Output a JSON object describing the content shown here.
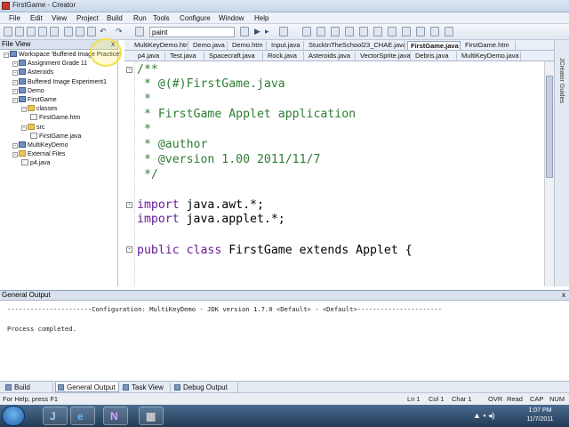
{
  "window": {
    "title": "FirstGame - Creator"
  },
  "menu": [
    "File",
    "Edit",
    "View",
    "Project",
    "Build",
    "Run",
    "Tools",
    "Configure",
    "Window",
    "Help"
  ],
  "toolbar": {
    "combo_value": "paint"
  },
  "fileview": {
    "title": "File View",
    "close": "x",
    "tree": [
      {
        "label": "Workspace 'Buffered Image Practice'",
        "kind": "prj",
        "indent": 0
      },
      {
        "label": "Assignment Grade 11",
        "kind": "prj",
        "indent": 1
      },
      {
        "label": "Asteroids",
        "kind": "prj",
        "indent": 1
      },
      {
        "label": "Buffered Image Experiment1",
        "kind": "prj",
        "indent": 1
      },
      {
        "label": "Demo",
        "kind": "prj",
        "indent": 1
      },
      {
        "label": "FirstGame",
        "kind": "prj",
        "indent": 1
      },
      {
        "label": "classes",
        "kind": "fold",
        "indent": 2
      },
      {
        "label": "FirstGame.htm",
        "kind": "file",
        "indent": 3
      },
      {
        "label": "src",
        "kind": "fold",
        "indent": 2
      },
      {
        "label": "FirstGame.java",
        "kind": "file",
        "indent": 3
      },
      {
        "label": "MultiKeyDemo",
        "kind": "prj",
        "indent": 1
      },
      {
        "label": "External Files",
        "kind": "fold",
        "indent": 1
      },
      {
        "label": "p4.java",
        "kind": "file",
        "indent": 2
      }
    ]
  },
  "tabs_row1": [
    "MultiKeyDemo.htm",
    "Demo.java",
    "Demo.htm",
    "Input.java",
    "StuckInTheSchool23_CHAE.java",
    "FirstGame.java",
    "FirstGame.htm"
  ],
  "tabs_row2": [
    "p4.java",
    "Test.java",
    "Spacecraft.java",
    "Rock.java",
    "Asteroids.java",
    "VectorSprite.java",
    "Debris.java",
    "MultiKeyDemo.java"
  ],
  "editor": {
    "lines": [
      {
        "cls": "cm",
        "text": "/**"
      },
      {
        "cls": "cm",
        "text": " * @(#)FirstGame.java"
      },
      {
        "cls": "cm",
        "text": " *"
      },
      {
        "cls": "cm",
        "text": " * FirstGame Applet application"
      },
      {
        "cls": "cm",
        "text": " *"
      },
      {
        "cls": "cm",
        "text": " * @author"
      },
      {
        "cls": "cm",
        "text": " * @version 1.00 2011/11/7"
      },
      {
        "cls": "cm",
        "text": " */"
      },
      {
        "cls": "pl",
        "text": ""
      },
      {
        "cls": "kw",
        "text": "import",
        "rest": " java.awt.*;"
      },
      {
        "cls": "kw",
        "text": "import",
        "rest": " java.applet.*;"
      },
      {
        "cls": "pl",
        "text": ""
      },
      {
        "cls": "kw",
        "text": "public class",
        "rest": " FirstGame extends Applet {"
      }
    ]
  },
  "right_strip": "JCreator Guides",
  "output": {
    "title": "General Output",
    "close": "x",
    "lines": [
      "----------------------Configuration: MultiKeyDemo - JDK version 1.7.0 <Default> - <Default>----------------------",
      "",
      "Process completed."
    ]
  },
  "output_tabs": [
    "Build Output",
    "General Output",
    "Task View",
    "Debug Output"
  ],
  "status": {
    "help": "For Help, press F1",
    "ln": "Ln 1",
    "col": "Col 1",
    "char": "Char 1",
    "ovr": "OVR",
    "read": "Read",
    "cap": "CAP",
    "num": "NUM"
  },
  "clock": {
    "time": "1:07 PM",
    "date": "11/7/2011"
  }
}
